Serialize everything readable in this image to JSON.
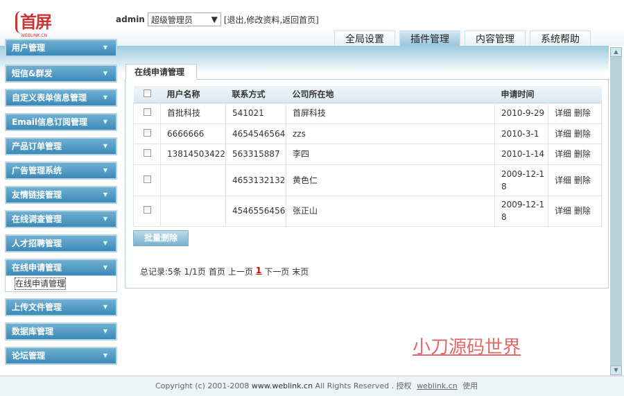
{
  "logo": {
    "text": "首屏",
    "sub": "WEBLINK.CN"
  },
  "user": {
    "name": "admin",
    "role": "超级管理员",
    "links": "[退出,修改资料,返回首页]"
  },
  "top_tabs": [
    {
      "label": "全局设置"
    },
    {
      "label": "插件管理"
    },
    {
      "label": "内容管理"
    },
    {
      "label": "系统帮助"
    }
  ],
  "sidebar": {
    "items": [
      {
        "label": "用户管理"
      },
      {
        "label": "短信&群发"
      },
      {
        "label": "自定义表单信息管理"
      },
      {
        "label": "Email信息订阅管理"
      },
      {
        "label": "产品订单管理"
      },
      {
        "label": "广告管理系统"
      },
      {
        "label": "友情链接管理"
      },
      {
        "label": "在线调查管理"
      },
      {
        "label": "人才招聘管理"
      },
      {
        "label": "在线申请管理"
      },
      {
        "label": "上传文件管理"
      },
      {
        "label": "数据库管理"
      },
      {
        "label": "论坛管理"
      }
    ],
    "sub_item": "在线申请管理"
  },
  "content": {
    "tab": "在线申请管理",
    "columns": [
      "用户名称",
      "联系方式",
      "公司所在地",
      "申请时间"
    ],
    "rows": [
      {
        "name": "首批科技",
        "contact": "541021",
        "address": "首屏科技",
        "date": "2010-9-29"
      },
      {
        "name": "6666666",
        "contact": "4654546564",
        "address": "zzs",
        "date": "2010-3-1"
      },
      {
        "name": "13814503422",
        "contact": "563315887",
        "address": "李四",
        "date": "2010-1-14"
      },
      {
        "name": "",
        "contact": "4653132132",
        "address": "黄色仁",
        "date": "2009-12-18"
      },
      {
        "name": "",
        "contact": "4546556456",
        "address": "张正山",
        "date": "2009-12-18"
      }
    ],
    "detail": "详细",
    "delete": "删除",
    "bulk_delete": "批量删除",
    "pager": {
      "summary": "总记录:5条 1/1页",
      "first": "首页",
      "prev": "上一页",
      "current": "1",
      "next": "下一页",
      "last": "末页"
    }
  },
  "watermark": "小刀源码世界",
  "footer": {
    "pre": "Copyright (c) 2001-2008",
    "site": "www.weblink.cn",
    "mid": "All Rights Reserved . 授权",
    "link": "weblink.cn",
    "post": "使用"
  }
}
